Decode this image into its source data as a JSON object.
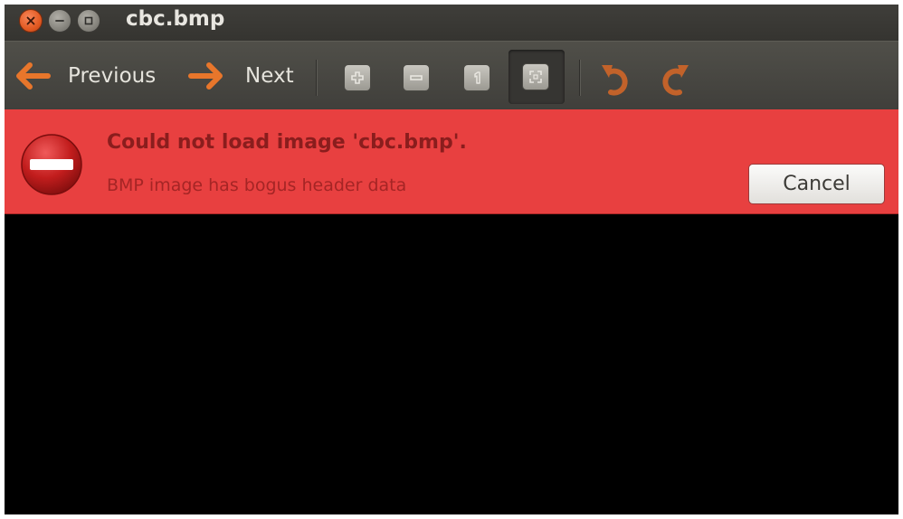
{
  "window": {
    "title": "cbc.bmp",
    "controls": {
      "close_icon": "close-icon",
      "minimize_icon": "minimize-icon",
      "maximize_icon": "maximize-icon"
    }
  },
  "toolbar": {
    "previous_label": "Previous",
    "next_label": "Next",
    "icons": [
      "arrow-left-icon",
      "arrow-right-icon",
      "zoom-in-icon",
      "zoom-out-icon",
      "zoom-normal-icon",
      "zoom-fit-icon",
      "rotate-left-icon",
      "rotate-right-icon"
    ],
    "accent_color": "#e8762b"
  },
  "infobar": {
    "title": "Could not load image 'cbc.bmp'.",
    "message": "BMP image has bogus header data",
    "cancel_label": "Cancel",
    "background_color": "#e84040",
    "icon": "error-icon"
  }
}
